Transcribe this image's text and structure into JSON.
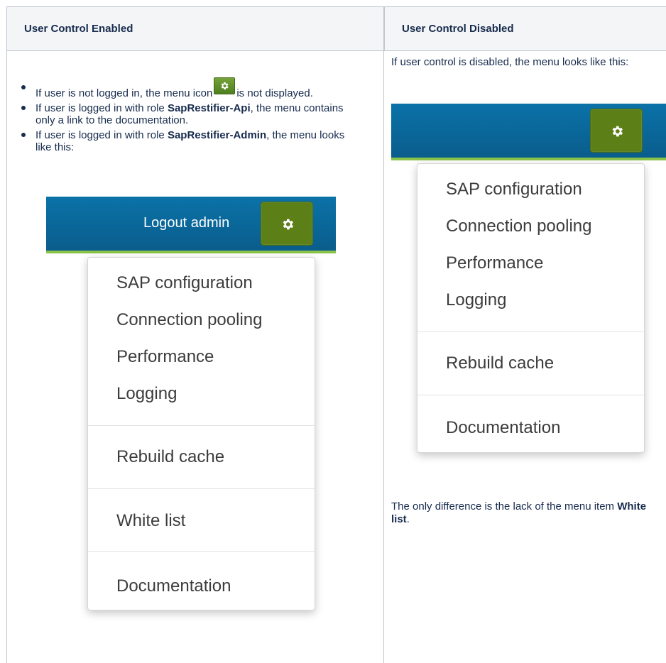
{
  "headers": {
    "left": "User Control Enabled",
    "right": "User Control Disabled"
  },
  "left": {
    "bullets": [
      {
        "a": "If user is not logged in, the menu icon",
        "b": "is not displayed."
      },
      {
        "a": "If user is logged in with role ",
        "bold": "SapRestifier-Api",
        "b": ", the menu contains only a link to the documentation."
      },
      {
        "a": "If user is logged in with role ",
        "bold": "SapRestifier-Admin",
        "b": ", the menu looks like this:"
      }
    ],
    "navbar": {
      "logout": "Logout admin"
    },
    "menu": [
      "SAP configuration",
      "Connection pooling",
      "Performance",
      "Logging",
      "Rebuild cache",
      "White list",
      "Documentation"
    ]
  },
  "right": {
    "intro": "If user control is disabled, the menu looks like this:",
    "menu": [
      "SAP configuration",
      "Connection pooling",
      "Performance",
      "Logging",
      "Rebuild cache",
      "Documentation"
    ],
    "outro_a": "The only difference is the lack of the menu item ",
    "outro_bold": "White list",
    "outro_b": "."
  },
  "icons": {
    "settings": "gear-icon"
  },
  "colors": {
    "navbar": "#0a6497",
    "accent": "#8bc34a",
    "button": "#5c7f17"
  }
}
